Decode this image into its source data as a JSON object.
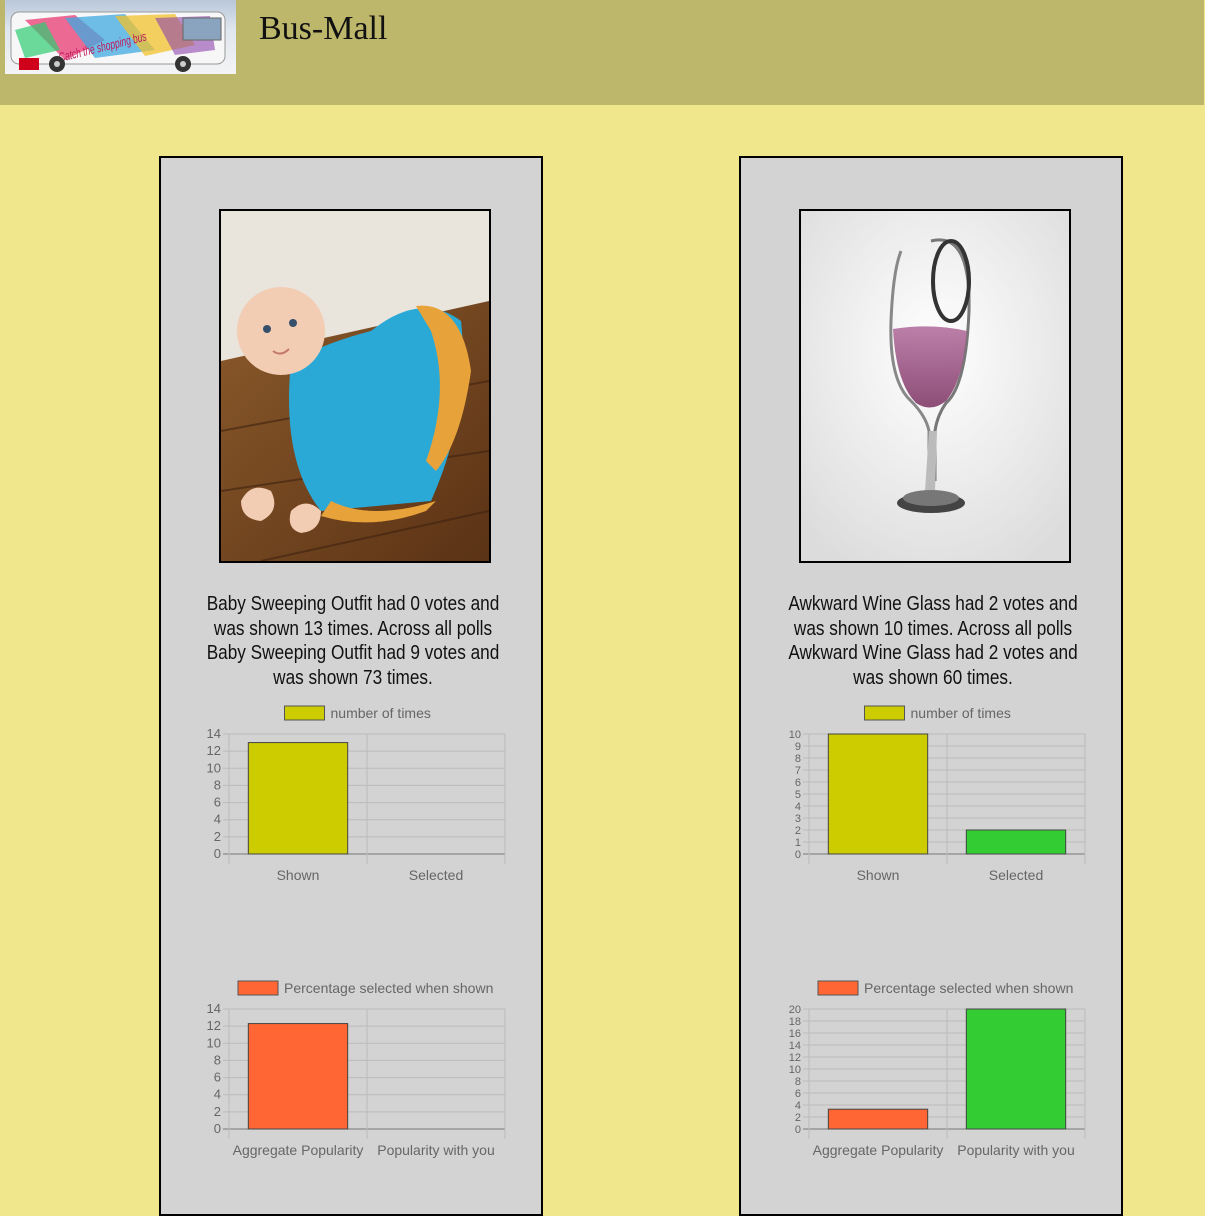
{
  "header": {
    "title": "Bus-Mall",
    "logo_text": "Catch the shopping bus"
  },
  "colors": {
    "background": "#F0E68C",
    "header": "#BDB76B",
    "card": "#D3D3D3",
    "shown_bar": "#CCCC00",
    "aggregate_bar": "#FF6633",
    "user_bar": "#33CC33"
  },
  "products": [
    {
      "name": "Baby Sweeping Outfit",
      "caption": "Baby Sweeping Outfit had 0 votes and was shown 13 times. Across all polls Baby Sweeping Outfit had 9 votes and was shown 73 times.",
      "image_icon": "baby-crawling-image"
    },
    {
      "name": "Awkward Wine Glass",
      "caption": "Awkward Wine Glass had 2 votes and was shown 10 times. Across all polls Awkward Wine Glass had 2 votes and was shown 60 times.",
      "image_icon": "wine-glass-image"
    }
  ],
  "chart_data": [
    {
      "type": "bar",
      "legend": "number of times",
      "categories": [
        "Shown",
        "Selected"
      ],
      "values": [
        13,
        0
      ],
      "colors": [
        "#CCCC00",
        "#CCCC00"
      ],
      "ylim": [
        0,
        14
      ],
      "yticks": [
        "14",
        "12",
        "10",
        "8",
        "6",
        "4",
        "2",
        "0"
      ]
    },
    {
      "type": "bar",
      "legend": "Percentage selected when shown",
      "categories": [
        "Aggregate Popularity",
        "Popularity with you"
      ],
      "values": [
        12.3,
        0
      ],
      "colors": [
        "#FF6633",
        "#33CC33"
      ],
      "ylim": [
        0,
        14
      ],
      "yticks": [
        "14",
        "12",
        "10",
        "8",
        "6",
        "4",
        "2",
        "0"
      ]
    },
    {
      "type": "bar",
      "legend": "number of times",
      "categories": [
        "Shown",
        "Selected"
      ],
      "values": [
        10,
        2
      ],
      "colors": [
        "#CCCC00",
        "#33CC33"
      ],
      "ylim": [
        0,
        10
      ],
      "yticks": [
        "10",
        "9",
        "8",
        "7",
        "6",
        "5",
        "4",
        "3",
        "2",
        "1",
        "0"
      ]
    },
    {
      "type": "bar",
      "legend": "Percentage selected when shown",
      "categories": [
        "Aggregate Popularity",
        "Popularity with you"
      ],
      "values": [
        3.3,
        20
      ],
      "colors": [
        "#FF6633",
        "#33CC33"
      ],
      "ylim": [
        0,
        20
      ],
      "yticks": [
        "20",
        "18",
        "16",
        "14",
        "12",
        "10",
        "8",
        "6",
        "4",
        "2",
        "0"
      ]
    }
  ]
}
